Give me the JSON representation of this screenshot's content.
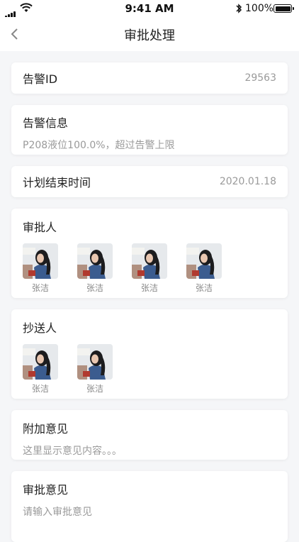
{
  "status": {
    "time": "9:41 AM",
    "battery": "100%"
  },
  "nav": {
    "title": "审批处理"
  },
  "alert_id": {
    "label": "告警ID",
    "value": "29563"
  },
  "alert_info": {
    "label": "告警信息",
    "content": "P208液位100.0%，超过告警上限"
  },
  "end_time": {
    "label": "计划结束时间",
    "value": "2020.01.18"
  },
  "approvers": {
    "label": "审批人",
    "people": [
      "张洁",
      "张洁",
      "张洁",
      "张洁"
    ]
  },
  "cc": {
    "label": "抄送人",
    "people": [
      "张洁",
      "张洁"
    ]
  },
  "extra_opinion": {
    "label": "附加意见",
    "content": "这里显示意见内容。。。"
  },
  "approval_opinion": {
    "label": "审批意见",
    "placeholder": "请输入审批意见"
  }
}
